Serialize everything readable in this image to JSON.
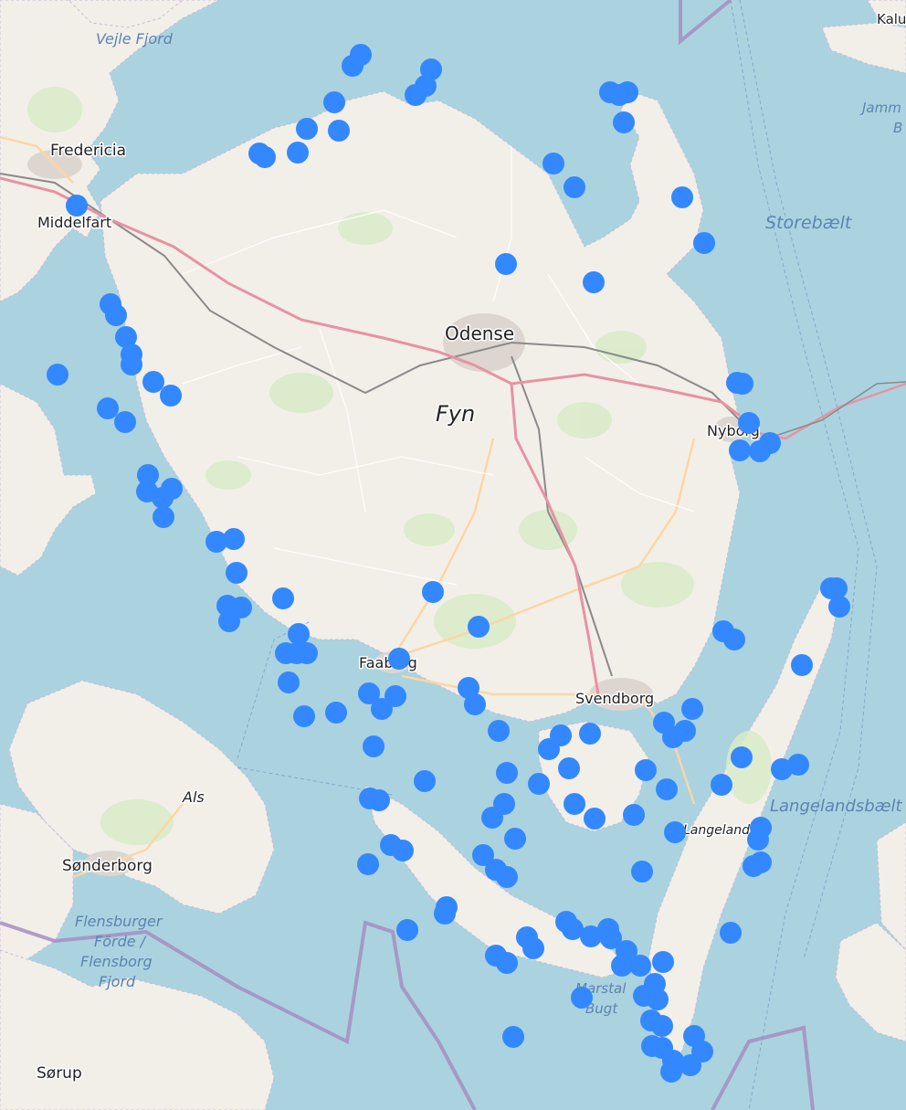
{
  "map": {
    "place_labels": {
      "odense": "Odense",
      "fyn": "Fyn",
      "fredericia": "Fredericia",
      "middelfart": "Middelfart",
      "nyborg": "Nyborg",
      "svendborg": "Svendborg",
      "faaborg": "Faaborg",
      "sonderborg": "Sønderborg",
      "als": "Als",
      "langeland": "Langeland",
      "sorup": "Sørup",
      "kalundborg": "Kalu"
    },
    "water_labels": {
      "vejle_fjord": "Vejle Fjord",
      "storebaelt": "Storebælt",
      "langelandsbaelt": "Langelandsbælt",
      "jammerland_1": "Jamm",
      "jammerland_2": "B",
      "flensburger_1": "Flensburger",
      "flensburger_2": "Förde /",
      "flensburger_3": "Flensborg",
      "flensburger_4": "Fjord",
      "marstal_1": "Marstal",
      "marstal_2": "Bugt"
    },
    "colors": {
      "water": "#aad3df",
      "land": "#f2efe9",
      "marker": "#3388ff",
      "border": "#a68dbf",
      "highway": "#e892a2",
      "railway": "#707070",
      "secondary_road": "#fcd6a4"
    }
  }
}
